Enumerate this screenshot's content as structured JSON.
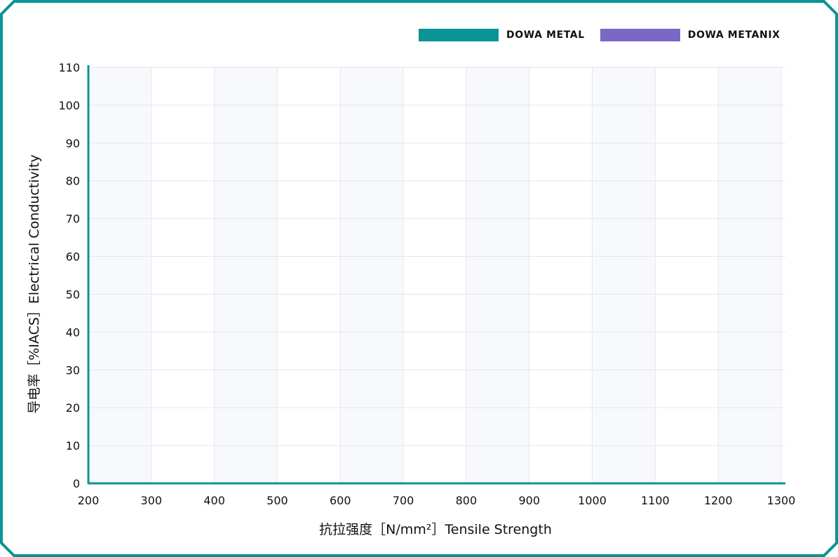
{
  "theme": {
    "frame_color": "#0a9496",
    "axis_color": "#0a9496",
    "band_color": "#f8f9fc",
    "grid_color": "#e4e6eb"
  },
  "legend": {
    "items": [
      {
        "label": "DOWA METAL",
        "color": "#0a9496"
      },
      {
        "label": "DOWA METANIX",
        "color": "#7a68c4"
      }
    ]
  },
  "chart_data": {
    "type": "scatter",
    "x_ticks": [
      "200",
      "300",
      "400",
      "500",
      "600",
      "700",
      "800",
      "900",
      "1000",
      "1100",
      "1200",
      "1300"
    ],
    "y_ticks": [
      "0",
      "10",
      "20",
      "30",
      "40",
      "50",
      "60",
      "70",
      "80",
      "90",
      "100",
      "110"
    ],
    "xlim": [
      200,
      1300
    ],
    "ylim": [
      0,
      110
    ],
    "xlabel": "抗拉强度［N/mm²］Tensile Strength",
    "ylabel": "导电率［%IACS］Electrical Conductivity",
    "grid": true,
    "legend_position": "top-right",
    "series": [
      {
        "name": "DOWA METAL",
        "color": "#0a9496",
        "points": []
      },
      {
        "name": "DOWA METANIX",
        "color": "#7a68c4",
        "points": []
      }
    ]
  }
}
